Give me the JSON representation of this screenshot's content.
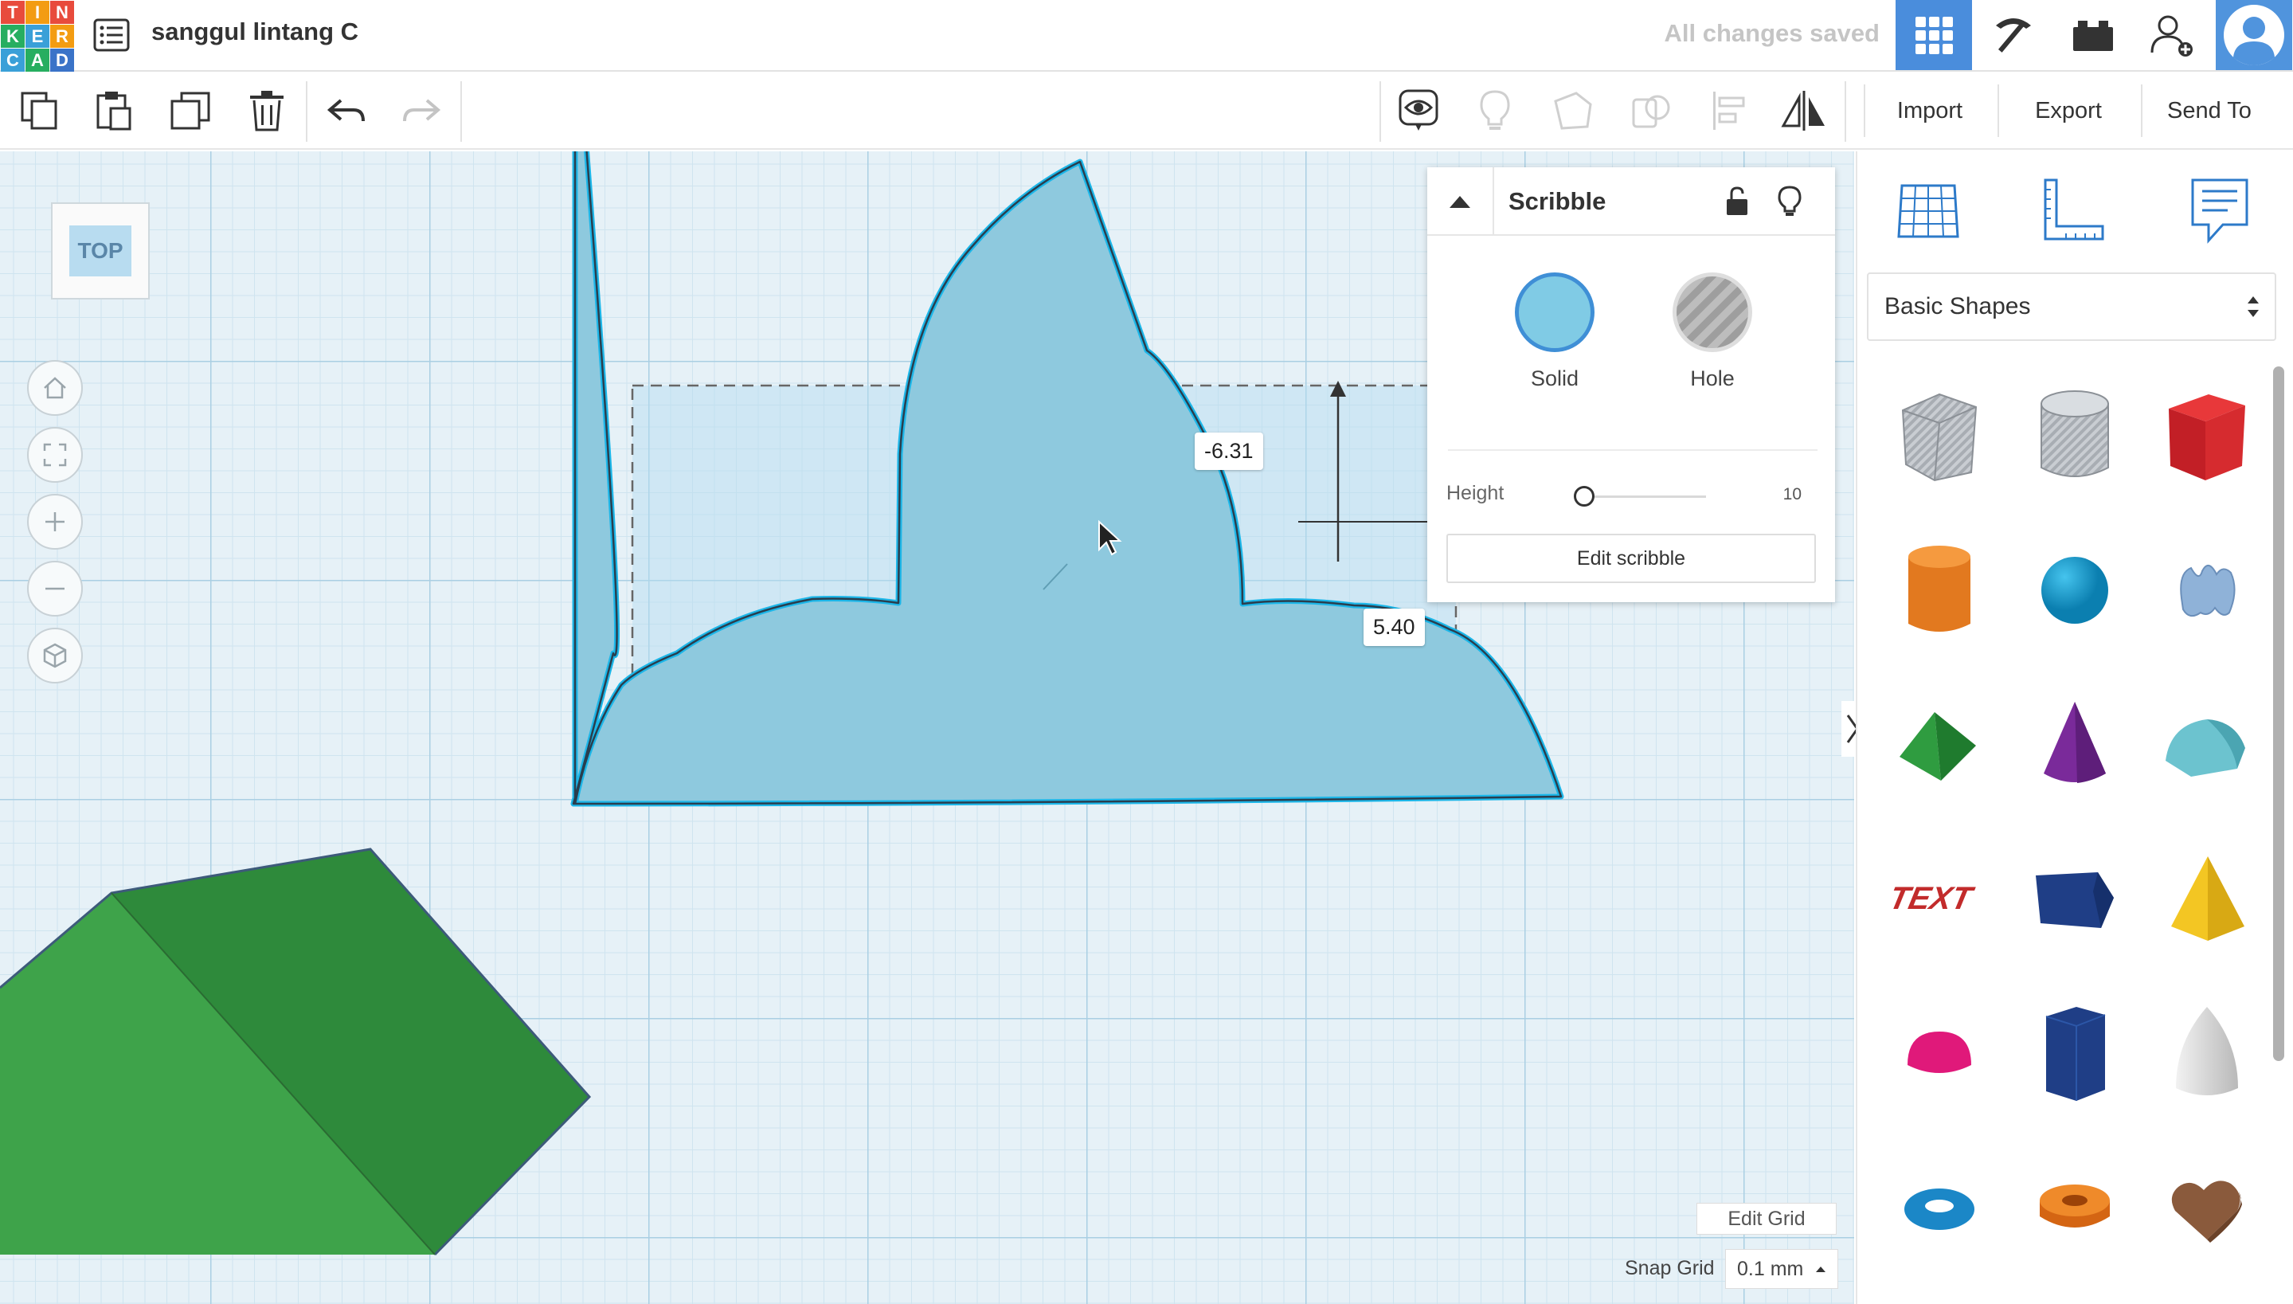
{
  "app": {
    "logo_letters": [
      "T",
      "I",
      "N",
      "K",
      "E",
      "R",
      "C",
      "A",
      "D"
    ],
    "logo_colors": [
      "#e84b3c",
      "#f39c12",
      "#e84b3c",
      "#27ae60",
      "#3aa0d8",
      "#f39c12",
      "#3aa0d8",
      "#27ae60",
      "#3a73c8"
    ],
    "document_title": "sanggul lintang C",
    "save_status": "All changes saved"
  },
  "header_buttons": [
    {
      "name": "3d-view-icon"
    },
    {
      "name": "codeblocks-icon"
    },
    {
      "name": "bricks-icon"
    },
    {
      "name": "invite-user-icon"
    },
    {
      "name": "user-avatar"
    }
  ],
  "toolbar": {
    "left_tools": [
      "copy-icon",
      "paste-icon",
      "duplicate-icon",
      "delete-icon",
      "undo-icon",
      "redo-icon"
    ],
    "right_tools": [
      "show-all-icon",
      "light-bulb-icon",
      "group-icon",
      "ungroup-icon",
      "align-icon",
      "mirror-icon"
    ],
    "import_label": "Import",
    "export_label": "Export",
    "send_to_label": "Send To"
  },
  "view_cube": {
    "label": "TOP"
  },
  "dimensions": {
    "label_a": "-6.31",
    "label_b": "5.40"
  },
  "inspector": {
    "shape_name": "Scribble",
    "solid_label": "Solid",
    "hole_label": "Hole",
    "height_label": "Height",
    "height_value": "10",
    "edit_button_label": "Edit scribble",
    "colors": {
      "solid": "#80cbe5",
      "accent": "#3f8fd6"
    }
  },
  "grid_controls": {
    "edit_grid_label": "Edit Grid",
    "snap_grid_label": "Snap Grid",
    "snap_grid_value": "0.1 mm"
  },
  "right_panel": {
    "tabs": [
      "workplane-icon",
      "ruler-icon",
      "notes-icon"
    ],
    "category": "Basic Shapes",
    "shapes": [
      "box-hole",
      "cylinder-hole",
      "box",
      "cylinder",
      "sphere",
      "scribble",
      "roof",
      "cone",
      "round-roof",
      "text",
      "prism",
      "pyramid",
      "half-sphere",
      "polygon",
      "paraboloid",
      "torus",
      "tube",
      "heart"
    ]
  }
}
